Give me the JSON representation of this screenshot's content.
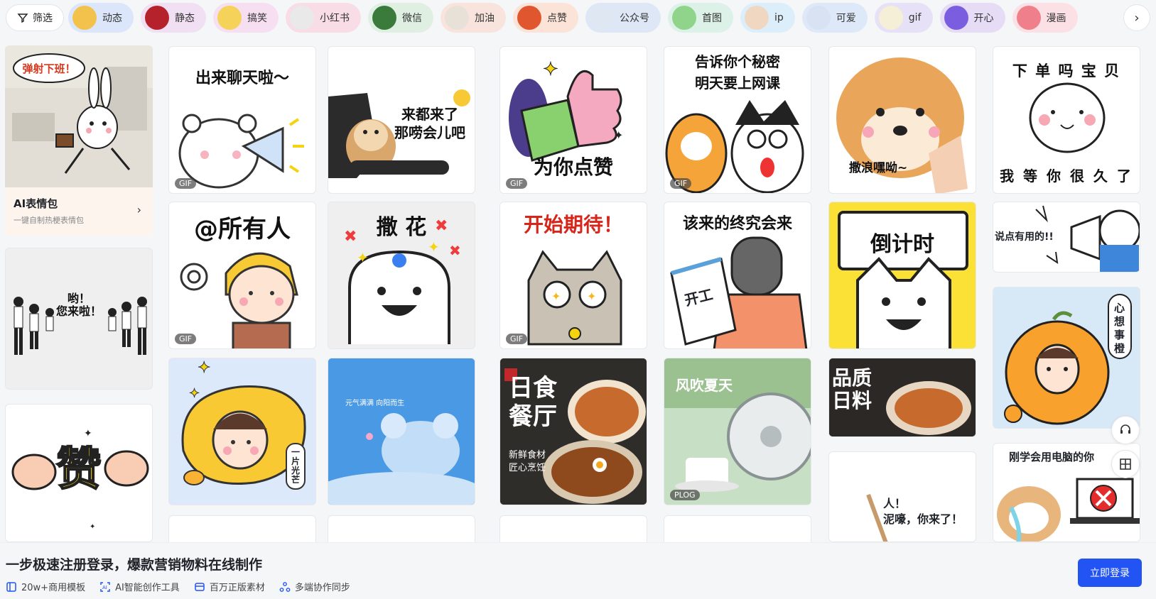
{
  "filter": {
    "label": "筛选"
  },
  "chips": [
    {
      "label": "动态",
      "bg": "#dbe6fb",
      "thumb": "#f2c24c"
    },
    {
      "label": "静态",
      "bg": "#f1e0f3",
      "thumb": "#b5222c"
    },
    {
      "label": "搞笑",
      "bg": "#f6dff0",
      "thumb": "#f5d35a"
    },
    {
      "label": "小红书",
      "bg": "#f8dde6",
      "thumb": "#e9e9e9"
    },
    {
      "label": "微信",
      "bg": "#dff0e3",
      "thumb": "#3a7a3b"
    },
    {
      "label": "加油",
      "bg": "#f8e4dc",
      "thumb": "#e8e1d8"
    },
    {
      "label": "点赞",
      "bg": "#fbe3d7",
      "thumb": "#e0562f"
    },
    {
      "label": "公众号",
      "bg": "#dde7f5",
      "thumb": "#dfe7f3"
    },
    {
      "label": "首图",
      "bg": "#dcf1e7",
      "thumb": "#8fd48a"
    },
    {
      "label": "ip",
      "bg": "#dbeefa",
      "thumb": "#f0d7c2"
    },
    {
      "label": "可爱",
      "bg": "#dde8f8",
      "thumb": "#d8e2f2"
    },
    {
      "label": "gif",
      "bg": "#e7e1f7",
      "thumb": "#f5efd7"
    },
    {
      "label": "开心",
      "bg": "#e6dcf6",
      "thumb": "#7b5ee0"
    },
    {
      "label": "漫画",
      "bg": "#fbe1e5",
      "thumb": "#ef7f8a"
    }
  ],
  "ai_card": {
    "title": "AI表情包",
    "subtitle": "一键自制热梗表情包",
    "art_text": "弹射下班！"
  },
  "cards": {
    "c1": {
      "text": "出来聊天啦～",
      "badge": "GIF"
    },
    "c2": {
      "text": "来都来了\n那唠会儿吧"
    },
    "c3": {
      "text": "为你点赞",
      "badge": "GIF"
    },
    "c4": {
      "text": "告诉你个秘密\n明天要上网课",
      "badge": "GIF"
    },
    "c5": {
      "text": "撒浪嘿呦~"
    },
    "c6": {
      "text1": "下 单 吗 宝 贝",
      "text2": "我 等 你 很 久 了"
    },
    "c7": {
      "text": "哟！\n您来啦！"
    },
    "c8": {
      "text": "@所有人",
      "badge": "GIF"
    },
    "c9": {
      "text": "撒 花"
    },
    "c10": {
      "text": "开始期待！",
      "badge": "GIF"
    },
    "c11": {
      "text": "该来的终究会来",
      "sub": "开工"
    },
    "c12": {
      "text": "倒计时"
    },
    "c13": {
      "text": "说点有用的!!"
    },
    "c14": {
      "text": "赞"
    },
    "c15": {
      "text": "一片光芒"
    },
    "c16": {
      "text": "元气满满  向阳而生"
    },
    "c17": {
      "text": "日食\n餐厅",
      "sub": "新鲜食材\n匠心烹饪"
    },
    "c18": {
      "text": "风吹夏天",
      "badge": "PLOG"
    },
    "c19": {
      "text": "品质\n日料"
    },
    "c20": {
      "text": "心想事橙"
    },
    "c21": {
      "text": "人！\n泥嚎，你来了！"
    },
    "c22": {
      "text": "刚学会用电脑的你"
    }
  },
  "bottom": {
    "title": "一步极速注册登录，爆款营销物料在线制作",
    "features": [
      "20w+商用模板",
      "AI智能创作工具",
      "百万正版素材",
      "多端协作同步"
    ],
    "login": "立即登录"
  }
}
